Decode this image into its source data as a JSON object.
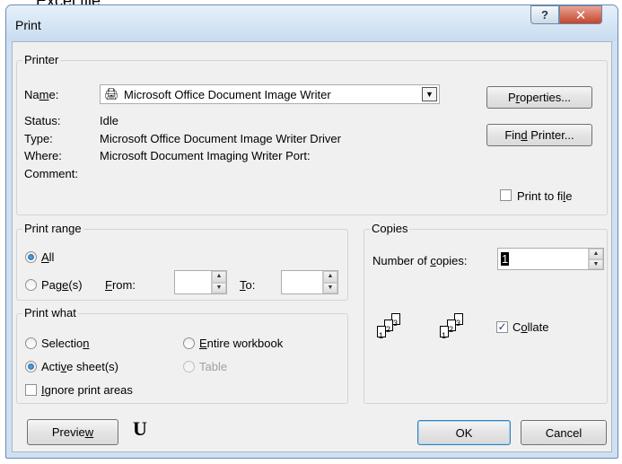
{
  "background_fragment": "Excel file.",
  "dialog": {
    "title": "Print",
    "help_glyph": "?",
    "close_glyph": "✕"
  },
  "printer": {
    "group_label": "Printer",
    "name_label": "Name:",
    "name_value": "Microsoft Office Document Image Writer",
    "status_label": "Status:",
    "status_value": "Idle",
    "type_label": "Type:",
    "type_value": "Microsoft Office Document Image Writer Driver",
    "where_label": "Where:",
    "where_value": "Microsoft Document Imaging Writer Port:",
    "comment_label": "Comment:",
    "properties_button": "Properties...",
    "find_printer_button": "Find Printer...",
    "print_to_file_label": "Print to file",
    "print_to_file_checked": false
  },
  "print_range": {
    "group_label": "Print range",
    "all_label": "All",
    "pages_label": "Page(s)",
    "from_label": "From:",
    "to_label": "To:",
    "from_value": "",
    "to_value": "",
    "selected": "all"
  },
  "print_what": {
    "group_label": "Print what",
    "selection_label": "Selection",
    "active_sheets_label": "Active sheet(s)",
    "entire_workbook_label": "Entire workbook",
    "table_label": "Table",
    "ignore_areas_label": "Ignore print areas",
    "selected": "active_sheets"
  },
  "copies": {
    "group_label": "Copies",
    "number_label": "Number of copies:",
    "number_value": "1",
    "collate_label": "Collate",
    "collate_checked": true,
    "page_numbers": [
      "1",
      "2",
      "3"
    ]
  },
  "footer": {
    "preview_button": "Preview",
    "ok_button": "OK",
    "cancel_button": "Cancel",
    "logo_glyph": "U"
  }
}
